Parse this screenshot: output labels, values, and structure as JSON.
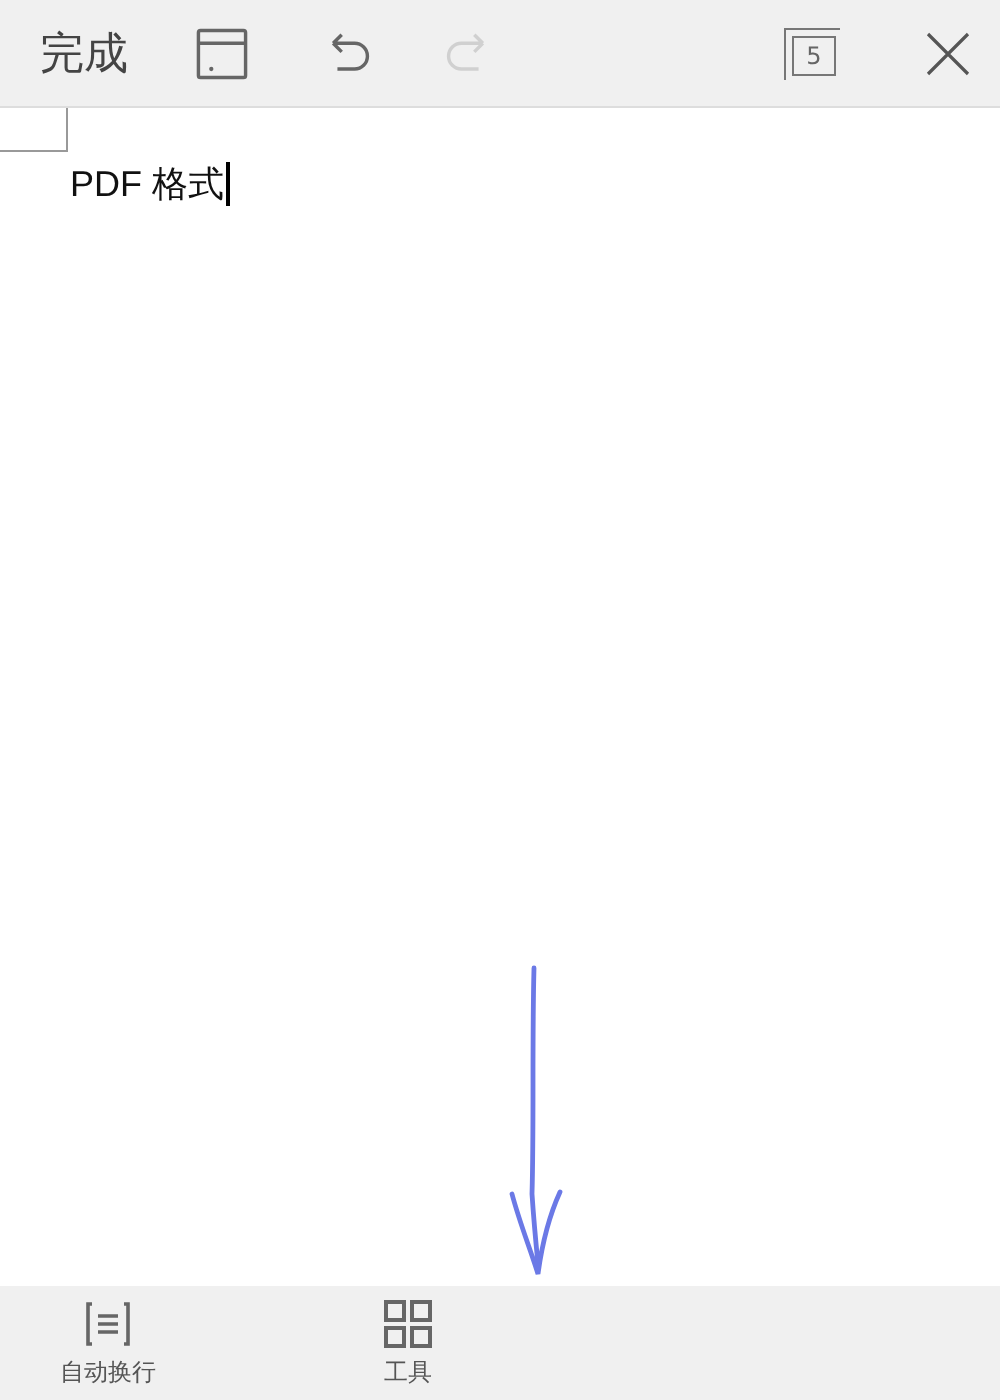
{
  "toolbar": {
    "done": "完成",
    "actions": [
      {
        "kind": "save",
        "disabled": false
      },
      {
        "kind": "undo",
        "disabled": false
      },
      {
        "kind": "redo",
        "disabled": true
      }
    ],
    "windows": {
      "count": "5"
    }
  },
  "document": {
    "text": "PDF 格式",
    "cursor": true
  },
  "bottom_bar": [
    {
      "kind": "wrap",
      "label": "自动换行"
    },
    {
      "kind": "tools",
      "label": "工具"
    }
  ]
}
